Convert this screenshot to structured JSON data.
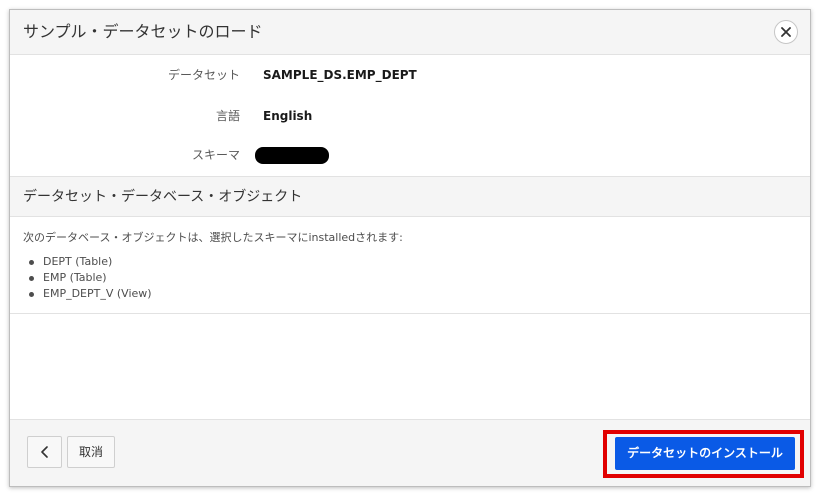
{
  "dialog": {
    "title": "サンプル・データセットのロード",
    "close_icon": "close-icon"
  },
  "fields": {
    "dataset": {
      "label": "データセット",
      "value": "SAMPLE_DS.EMP_DEPT"
    },
    "language": {
      "label": "言語",
      "value": "English"
    },
    "schema": {
      "label": "スキーマ",
      "value_redacted": true
    }
  },
  "objects_section": {
    "title": "データセット・データベース・オブジェクト",
    "description": "次のデータベース・オブジェクトは、選択したスキーマにinstalledされます:",
    "items": [
      "DEPT (Table)",
      "EMP (Table)",
      "EMP_DEPT_V (View)"
    ]
  },
  "footer": {
    "back_icon": "chevron-left-icon",
    "cancel_label": "取消",
    "install_label": "データセットのインストール"
  },
  "colors": {
    "primary_button": "#0a5ae6",
    "highlight_border": "#e10000"
  }
}
